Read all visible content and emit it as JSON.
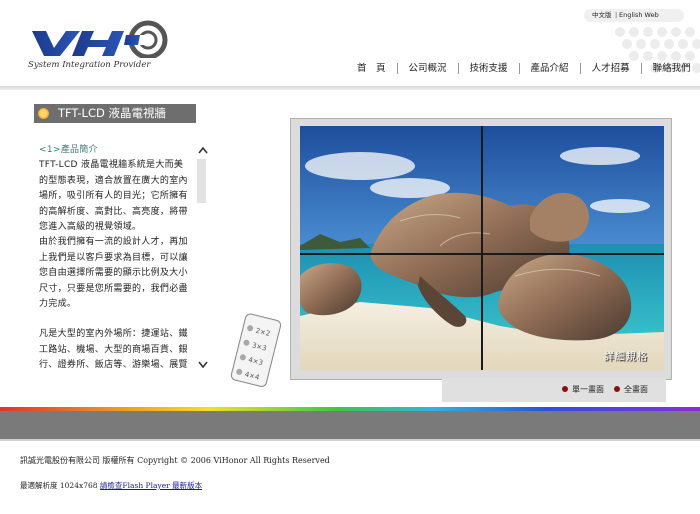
{
  "header": {
    "logo_text": "VHO",
    "tagline": "System Integration Provider",
    "lang": {
      "zh": "中文版",
      "separator": "|",
      "en": "English Web"
    },
    "nav": [
      "首　頁",
      "公司概況",
      "技術支援",
      "產品介紹",
      "人才招募",
      "聯絡我們"
    ]
  },
  "section": {
    "title": "TFT-LCD 液晶電視牆"
  },
  "description": {
    "heading": "<1>產品簡介",
    "paragraphs": [
      "TFT-LCD 液晶電視牆系統是大而美的型態表現，適合放置在廣大的室內場所，吸引所有人的目光；它所擁有的高解析度、高對比、高亮度，將帶您進入高級的視覺領域。",
      "由於我們擁有一流的設計人才，再加上我們是以客戶要求為目標，可以讓您自由選擇所需要的顯示比例及大小尺寸，只要是您所需要的，我們必盡力完成。",
      "凡是大型的室內外場所：捷運站、鐵工路站、機場、大型的商場百貨、銀行、證券所、飯店等、游樂場、展覽"
    ]
  },
  "remote": {
    "options": [
      "2×2",
      "3×3",
      "4×3",
      "4×4"
    ]
  },
  "display": {
    "detail_link": "詳細規格",
    "modes": {
      "single": "單一畫面",
      "full": "全畫面"
    }
  },
  "footer": {
    "copyright": "訊誠光電股份有限公司 版權所有 Copyright © 2006 ViHonor All Rights Reserved",
    "resolution_text": "最適解析度 1024x768 ",
    "flash_link": "請檢查Flash Player 最新版本"
  },
  "colors": {
    "accent_brand": "#1b3a8c",
    "section_title_bg": "#6e6e6e",
    "mode_dot": "#8b1010"
  }
}
